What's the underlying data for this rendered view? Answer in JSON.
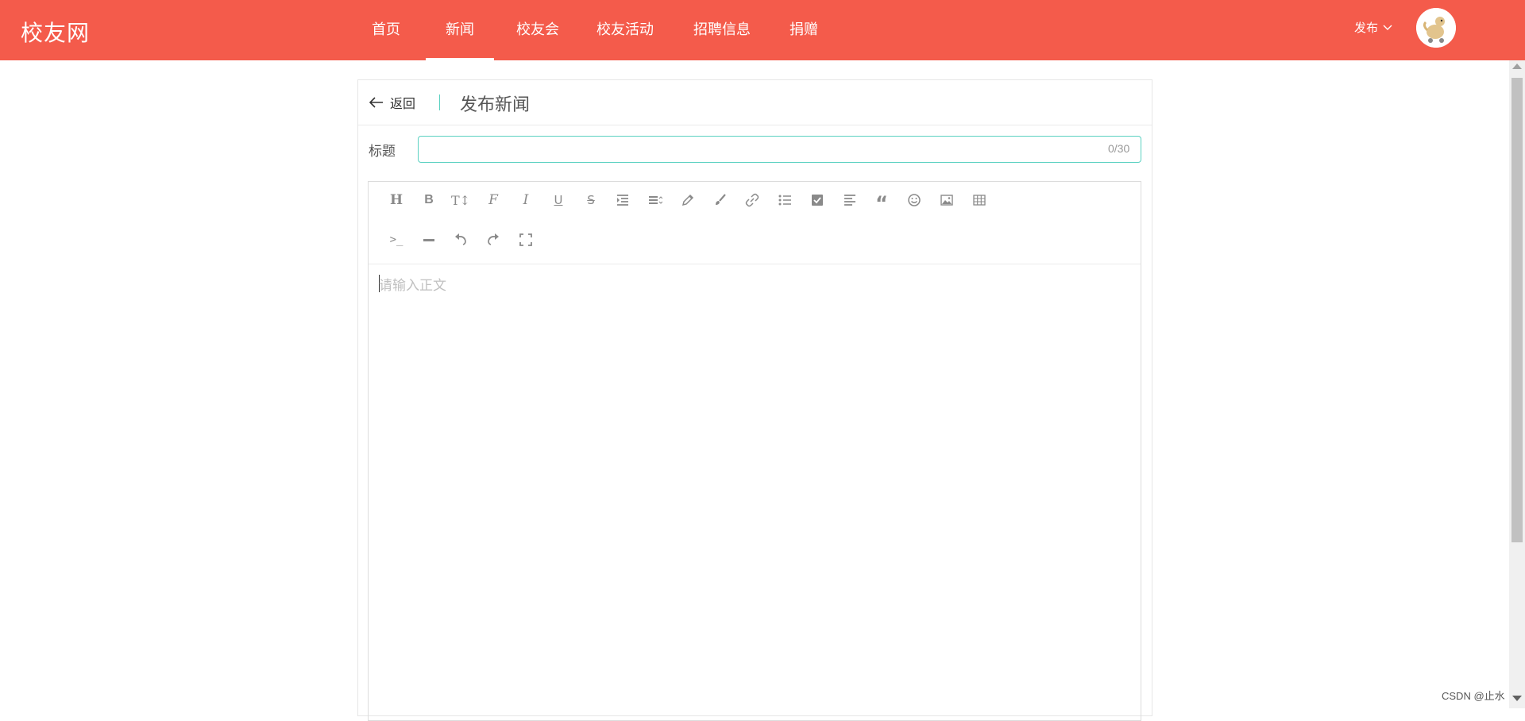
{
  "header": {
    "brand": "校友网",
    "nav": [
      {
        "label": "首页",
        "active": false
      },
      {
        "label": "新闻",
        "active": true
      },
      {
        "label": "校友会",
        "active": false
      },
      {
        "label": "校友活动",
        "active": false
      },
      {
        "label": "招聘信息",
        "active": false
      },
      {
        "label": "捐赠",
        "active": false
      }
    ],
    "publish_menu": "发布",
    "accent_color": "#f45b4b"
  },
  "page": {
    "back_label": "返回",
    "title": "发布新闻"
  },
  "form": {
    "title_label": "标题",
    "title_value": "",
    "title_counter": "0/30",
    "body_placeholder": "请输入正文",
    "focus_color": "#5ad1c1"
  },
  "toolbar": {
    "row1": [
      "heading-icon",
      "bold-icon",
      "font-size-icon",
      "font-family-icon",
      "italic-icon",
      "underline-icon",
      "strikethrough-icon",
      "indent-icon",
      "line-height-icon",
      "pencil-icon",
      "brush-icon",
      "link-icon",
      "list-icon",
      "checkbox-icon",
      "align-left-icon",
      "quote-icon",
      "emoji-icon",
      "image-icon",
      "table-icon"
    ],
    "row2": [
      "code-icon",
      "divider-icon",
      "undo-icon",
      "redo-icon",
      "fullscreen-icon"
    ]
  },
  "watermark": "CSDN @止水"
}
